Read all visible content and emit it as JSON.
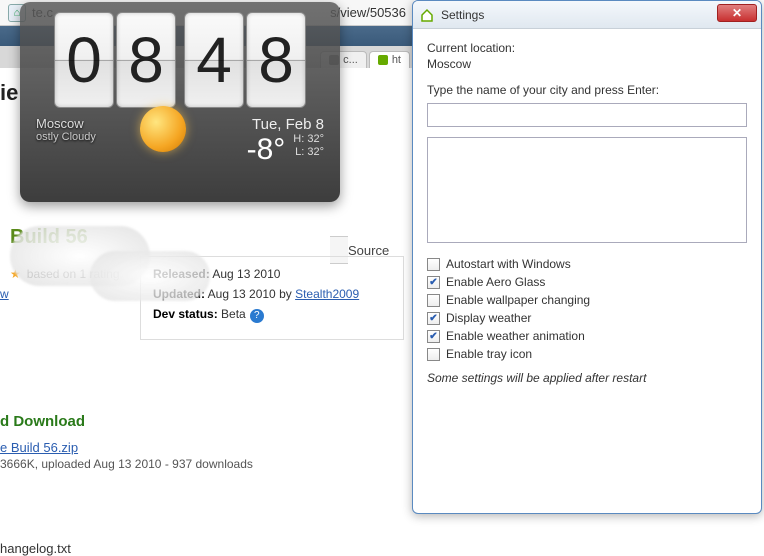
{
  "browser": {
    "url_left": "te.c",
    "url_right": "s/view/50536",
    "tab1": "c...",
    "tab2": "ht"
  },
  "page": {
    "title_frag": "ie",
    "build": "Build 56",
    "rating": "based on 1 rating",
    "released_lbl": "Released:",
    "released": "Aug 13 2010",
    "updated_lbl": "Updated:",
    "updated": "Aug 13 2010 by",
    "author": "Stealth2009",
    "devstatus_lbl": "Dev status:",
    "devstatus": "Beta",
    "dl_head": "d Download",
    "dl_file": "e Build 56.zip",
    "dl_meta": "3666K, uploaded Aug 13 2010 - 937 downloads",
    "changelog": "hangelog.txt",
    "source_tab": "Source"
  },
  "widget": {
    "h1": "0",
    "h2": "8",
    "m1": "4",
    "m2": "8",
    "city": "Moscow",
    "cond": "ostly Cloudy",
    "date": "Tue, Feb 8",
    "temp": "-8°",
    "hi_lbl": "H:",
    "hi": "32°",
    "lo_lbl": "L:",
    "lo": "32°"
  },
  "settings": {
    "title": "Settings",
    "loc_lbl": "Current location:",
    "loc": "Moscow",
    "hint": "Type the name of your city and press Enter:",
    "input": "",
    "checks": [
      {
        "label": "Autostart with Windows",
        "on": false
      },
      {
        "label": "Enable Aero Glass",
        "on": true
      },
      {
        "label": "Enable wallpaper changing",
        "on": false
      },
      {
        "label": "Display weather",
        "on": true
      },
      {
        "label": "Enable weather animation",
        "on": true
      },
      {
        "label": "Enable tray icon",
        "on": false
      }
    ],
    "note": "Some settings will be applied after restart"
  }
}
